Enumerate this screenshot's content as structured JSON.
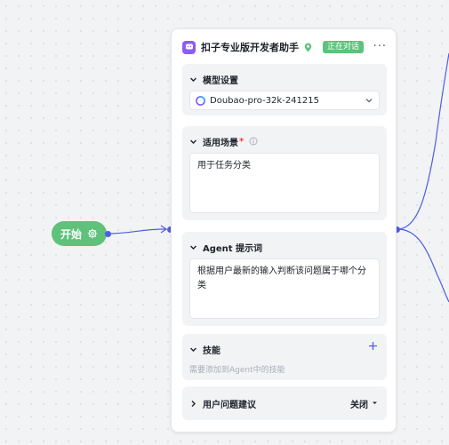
{
  "start_node": {
    "label": "开始",
    "icon": "gear-icon"
  },
  "node": {
    "title": "扣子专业版开发者助手",
    "status": "正在对话",
    "icons": {
      "agent": "chat-bubble-icon",
      "pin": "location-pin-icon",
      "more": "more-icon"
    },
    "sections": {
      "model": {
        "title": "模型设置",
        "selected_model": "Doubao-pro-32k-241215"
      },
      "scenario": {
        "title": "适用场景",
        "required_mark": "*",
        "value": "用于任务分类"
      },
      "prompt": {
        "title": "Agent 提示词",
        "value": "根据用户最新的输入判断该问题属于哪个分类"
      },
      "skills": {
        "title": "技能",
        "hint": "需要添加到Agent中的技能"
      },
      "suggestions": {
        "title": "用户问题建议",
        "value": "关闭"
      }
    }
  },
  "colors": {
    "accent": "#4e5ee4",
    "start_node": "#5ec27a",
    "status_badge": "#5ec27a",
    "agent_icon": "#8b5cf6"
  }
}
